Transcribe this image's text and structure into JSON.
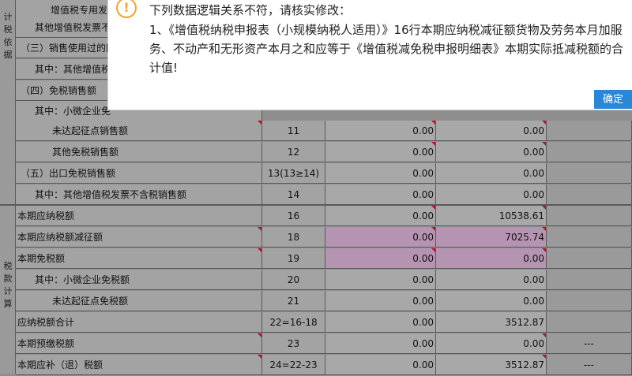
{
  "side_labels": {
    "group1": [
      "计",
      "税",
      "依",
      "据"
    ],
    "group2": [
      "税",
      "款",
      "计",
      "算"
    ]
  },
  "rows_top": [
    {
      "name": "增值税专用发票不"
    },
    {
      "name": "其他增值税发票不"
    },
    {
      "name": "（三）销售使用过的固"
    },
    {
      "name": "其中：其他增值税发"
    },
    {
      "name": "（四）免税销售额"
    },
    {
      "name": "其中：小微企业免"
    }
  ],
  "rows": [
    {
      "name": "未达起征点销售额",
      "line": "11",
      "v1": "0.00",
      "v2": "0.00",
      "v3": ""
    },
    {
      "name": "其他免税销售额",
      "line": "12",
      "v1": "0.00",
      "v2": "0.00",
      "v3": ""
    },
    {
      "name": "（五）出口免税销售额",
      "line": "13(13≥14)",
      "v1": "0.00",
      "v2": "0.00",
      "v3": ""
    },
    {
      "name": "其中：其他增值税发票不含税销售额",
      "line": "14",
      "v1": "0.00",
      "v2": "0.00",
      "v3": ""
    },
    {
      "name": "本期应纳税额",
      "line": "16",
      "v1": "0.00",
      "v2": "10538.61",
      "v3": ""
    },
    {
      "name": "本期应纳税额减征额",
      "line": "18",
      "v1": "0.00",
      "v2": "7025.74",
      "v3": ""
    },
    {
      "name": "本期免税额",
      "line": "19",
      "v1": "0.00",
      "v2": "0.00",
      "v3": ""
    },
    {
      "name": "其中：小微企业免税额",
      "line": "20",
      "v1": "0.00",
      "v2": "0.00",
      "v3": ""
    },
    {
      "name": "未达起征点免税额",
      "line": "21",
      "v1": "0.00",
      "v2": "0.00",
      "v3": ""
    },
    {
      "name": "应纳税额合计",
      "line": "22=16-18",
      "v1": "0.00",
      "v2": "3512.87",
      "v3": ""
    },
    {
      "name": "本期预缴税额",
      "line": "23",
      "v1": "0.00",
      "v2": "0.00",
      "v3": "---"
    },
    {
      "name": "本期应补（退）税额",
      "line": "24=22-23",
      "v1": "0.00",
      "v2": "3512.87",
      "v3": "---"
    }
  ],
  "dialog": {
    "icon": "warning-icon",
    "icon_glyph": "!",
    "title": "下列数据逻辑关系不符，请核实修改：",
    "message": "1、《增值税纳税申报表（小规模纳税人适用）》16行本期应纳税减征额货物及劳务本月加服务、不动产和无形资产本月之和应等于《增值税减免税申报明细表》本期实际抵减税额的合计值!",
    "ok_label": "确定"
  },
  "colors": {
    "highlight": "#b594b2",
    "button": "#2a86d6",
    "warn": "#f0a72a"
  }
}
